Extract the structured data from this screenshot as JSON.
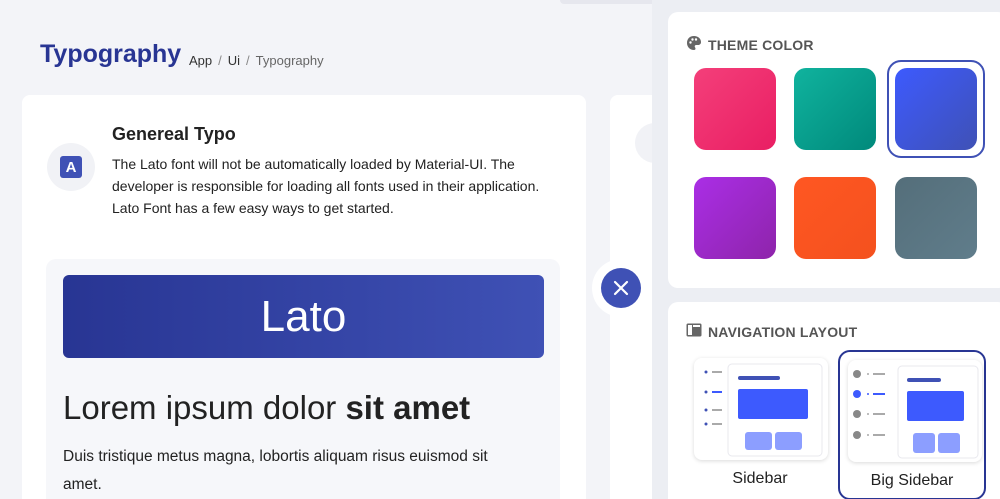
{
  "header": {
    "title": "Typography",
    "breadcrumb": [
      "App",
      "Ui",
      "Typography"
    ]
  },
  "card": {
    "title": "Genereal Typo",
    "description": "The Lato font will not be automatically loaded by Material-UI. The developer is responsible for loading all fonts used in their application. Lato Font has a few easy ways to get started.",
    "avatar_letter": "A",
    "banner_text": "Lato",
    "heading_normal": "Lorem ipsum dolor ",
    "heading_bold": "sit amet",
    "body_text": "Duis tristique metus magna, lobortis aliquam risus euismod sit amet."
  },
  "panel": {
    "theme_color_label": "THEME COLOR",
    "theme_icon": "palette-icon",
    "swatches": [
      {
        "name": "pink",
        "from": "#f43f7a",
        "to": "#e91e63",
        "selected": false
      },
      {
        "name": "teal",
        "from": "#10b39e",
        "to": "#00897b",
        "selected": false
      },
      {
        "name": "indigo",
        "from": "#3d5afe",
        "to": "#3f51b5",
        "selected": true
      },
      {
        "name": "purple",
        "from": "#aa2ee6",
        "to": "#8e24aa",
        "selected": false
      },
      {
        "name": "deep-orange",
        "from": "#ff5722",
        "to": "#f4511e",
        "selected": false
      },
      {
        "name": "blue-grey",
        "from": "#546e7a",
        "to": "#607d8b",
        "selected": false
      }
    ],
    "navigation_layout_label": "NAVIGATION LAYOUT",
    "navigation_icon": "layout-icon",
    "layouts": [
      {
        "label": "Sidebar",
        "selected": false
      },
      {
        "label": "Big Sidebar",
        "selected": true
      }
    ]
  },
  "colors": {
    "primary": "#3f51b5",
    "primary_dark": "#283593"
  }
}
